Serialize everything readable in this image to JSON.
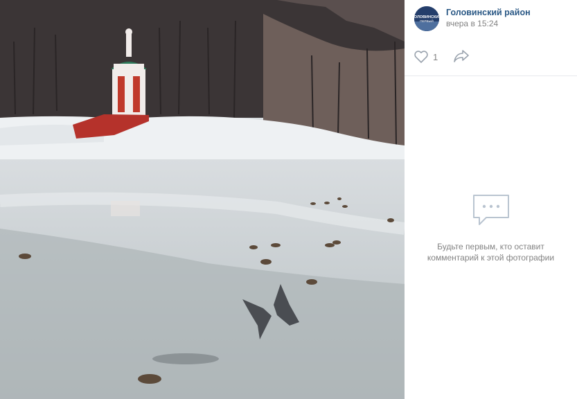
{
  "photo": {
    "description_icon": "photo-lake-winter"
  },
  "post": {
    "author": "Головинский район",
    "time": "вчера в 15:24",
    "avatar_text": "ГОЛОВИНСКИЙ ПЕРВЫЙ"
  },
  "actions": {
    "like_icon": "heart-icon",
    "like_count": "1",
    "share_icon": "share-arrow-icon"
  },
  "comments": {
    "empty_icon": "comment-bubble-icon",
    "empty_text": "Будьте первым, кто оставит комментарий к этой фотографии"
  },
  "colors": {
    "link": "#2a5885",
    "muted": "#828282",
    "icon": "#99a2ad",
    "divider": "#e7e8ec"
  }
}
